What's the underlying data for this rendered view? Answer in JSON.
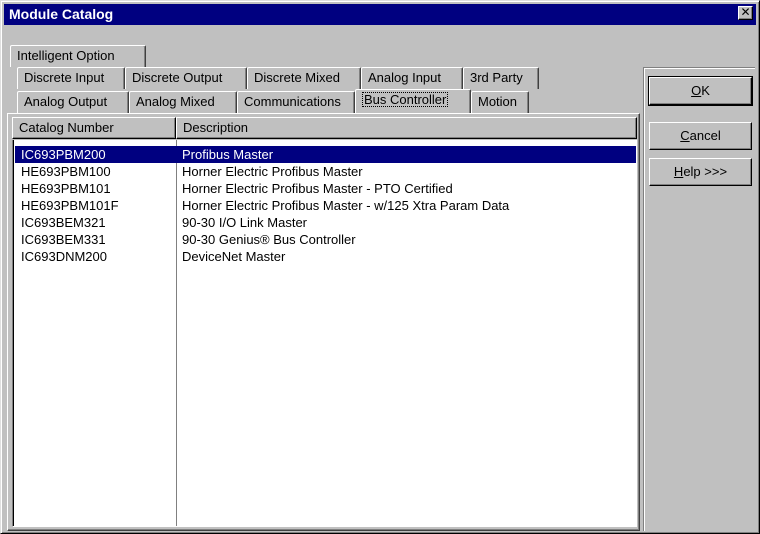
{
  "window": {
    "title": "Module Catalog",
    "close_glyph": "✕"
  },
  "tabs": {
    "row1": [
      "Intelligent Option"
    ],
    "row2": [
      "Discrete Input",
      "Discrete Output",
      "Discrete Mixed",
      "Analog Input",
      "3rd Party"
    ],
    "row3": [
      "Analog Output",
      "Analog Mixed",
      "Communications",
      "Bus Controller",
      "Motion"
    ],
    "active": "Bus Controller"
  },
  "list": {
    "columns": [
      "Catalog Number",
      "Description"
    ],
    "rows": [
      {
        "catalog": "IC693PBM200",
        "description": "Profibus Master",
        "selected": true
      },
      {
        "catalog": "HE693PBM100",
        "description": "Horner Electric Profibus Master",
        "selected": false
      },
      {
        "catalog": "HE693PBM101",
        "description": "Horner Electric Profibus Master - PTO Certified",
        "selected": false
      },
      {
        "catalog": "HE693PBM101F",
        "description": "Horner Electric Profibus Master - w/125 Xtra Param Data",
        "selected": false
      },
      {
        "catalog": "IC693BEM321",
        "description": "90-30 I/O Link Master",
        "selected": false
      },
      {
        "catalog": "IC693BEM331",
        "description": "90-30 Genius® Bus Controller",
        "selected": false
      },
      {
        "catalog": "IC693DNM200",
        "description": "DeviceNet Master",
        "selected": false
      }
    ]
  },
  "buttons": {
    "ok": {
      "mnemonic": "O",
      "rest": "K"
    },
    "cancel": {
      "mnemonic": "C",
      "rest": "ancel"
    },
    "help": {
      "mnemonic": "H",
      "rest": "elp >>>"
    }
  },
  "colors": {
    "selection": "#000080",
    "titlebar": "#000080",
    "face": "#c0c0c0"
  }
}
